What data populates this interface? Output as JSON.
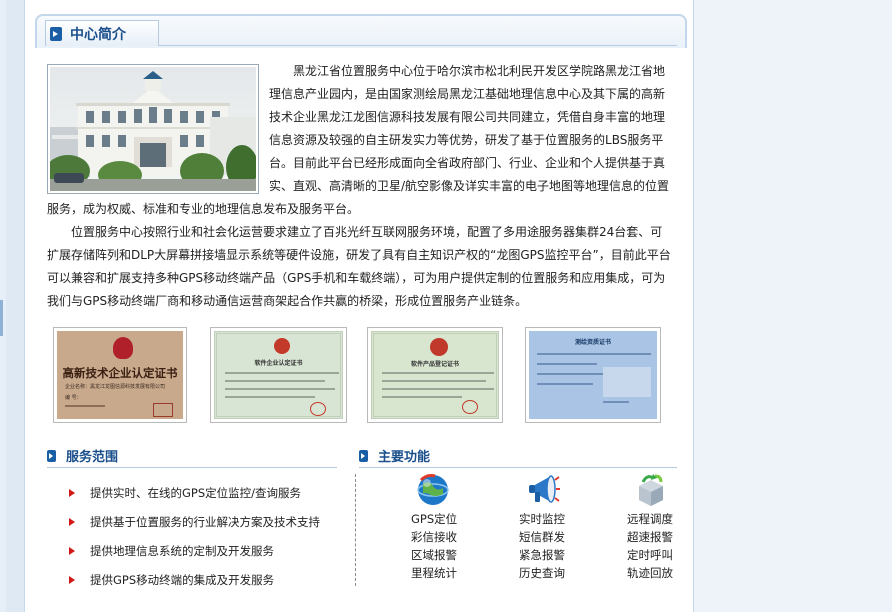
{
  "section_title": "中心简介",
  "intro": {
    "paragraph1": "黑龙江省位置服务中心位于哈尔滨市松北利民开发区学院路黑龙江省地理信息产业园内，是由国家测绘局黑龙江基础地理信息中心及其下属的高新技术企业黑龙江龙图信源科技发展有限公司共同建立，凭借自身丰富的地理信息资源及较强的自主研发实力等优势，研发了基于位置服务的LBS服务平台。目前此平台已经形成面向全省政府部门、行业、企业和个人提供基于真实、直观、高清晰的卫星/航空影像及详实丰富的电子地图等地理信息的位置服务，成为权威、标准和专业的地理信息发布及服务平台。",
    "paragraph2": "位置服务中心按照行业和社会化运营要求建立了百兆光纤互联网服务环境，配置了多用途服务器集群24台套、可扩展存储阵列和DLP大屏幕拼接墙显示系统等硬件设施，研发了具有自主知识产权的“龙图GPS监控平台”，目前此平台可以兼容和扩展支持多种GPS移动终端产品（GPS手机和车载终端），可为用户提供定制的位置服务和应用集成，可为我们与GPS移动终端厂商和移动通信运营商架起合作共赢的桥梁，形成位置服务产业链条。"
  },
  "certificates": [
    {
      "title": "高新技术企业认定证书",
      "name_line": "企业名称：黑龙江龙图信源科技发展有限公司",
      "num_line": "编 号：",
      "color": "#c8a98c"
    },
    {
      "title": "软件企业认定证书",
      "color": "#d9e5d4"
    },
    {
      "title": "软件产品登记证书",
      "color": "#d8e6cf"
    },
    {
      "title": "测绘资质证书",
      "color": "#a9c4e4"
    }
  ],
  "services": {
    "title": "服务范围",
    "items": [
      "提供实时、在线的GPS定位监控/查询服务",
      "提供基于位置服务的行业解决方案及技术支持",
      "提供地理信息系统的定制及开发服务",
      "提供GPS移动终端的集成及开发服务"
    ]
  },
  "features": {
    "title": "主要功能",
    "columns": [
      {
        "icon": "globe-icon",
        "items": [
          "GPS定位",
          "彩信接收",
          "区域报警",
          "里程统计"
        ]
      },
      {
        "icon": "megaphone-icon",
        "items": [
          "实时监控",
          "短信群发",
          "紧急报警",
          "历史查询"
        ]
      },
      {
        "icon": "recycle-box-icon",
        "items": [
          "远程调度",
          "超速报警",
          "定时呼叫",
          "轨迹回放"
        ]
      }
    ]
  },
  "colors": {
    "heading": "#1a4f8c",
    "bullet": "#d31717",
    "border": "#b5cbe3"
  }
}
